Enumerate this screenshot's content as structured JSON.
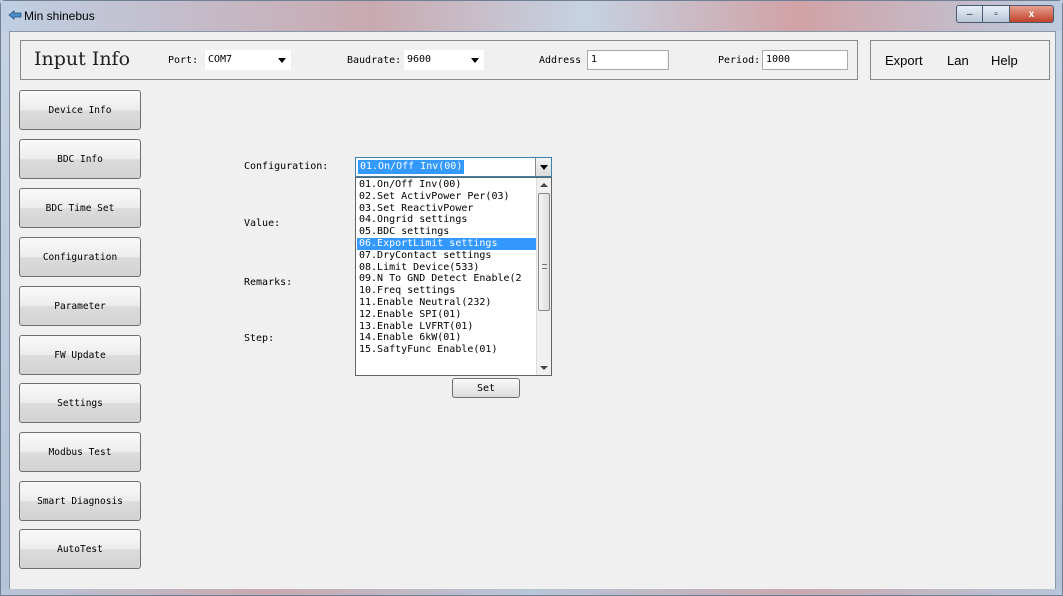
{
  "window": {
    "title": "Min shinebus",
    "icon": "app-icon",
    "controls": {
      "minimize": "–",
      "maximize": "▫",
      "close": "x"
    }
  },
  "infobar": {
    "title": "Input Info",
    "port_label": "Port:",
    "port_value": "COM7",
    "baud_label": "Baudrate:",
    "baud_value": "9600",
    "address_label": "Address",
    "address_value": "1",
    "period_label": "Period:",
    "period_value": "1000"
  },
  "menu": {
    "export": "Export",
    "lan": "Lan",
    "help": "Help"
  },
  "sidebar": {
    "items": [
      {
        "label": "Device Info"
      },
      {
        "label": "BDC Info"
      },
      {
        "label": "BDC Time Set"
      },
      {
        "label": "Configuration"
      },
      {
        "label": "Parameter"
      },
      {
        "label": "FW Update"
      },
      {
        "label": "Settings"
      },
      {
        "label": "Modbus Test"
      },
      {
        "label": "Smart Diagnosis"
      },
      {
        "label": "AutoTest"
      }
    ]
  },
  "form": {
    "configuration_label": "Configuration:",
    "configuration_value": "01.On/Off Inv(00)",
    "value_label": "Value:",
    "remarks_label": "Remarks:",
    "step_label": "Step:",
    "set_button": "Set"
  },
  "dropdown": {
    "highlighted_index": 5,
    "options": [
      "01.On/Off Inv(00)",
      "02.Set ActivPower Per(03)",
      "03.Set ReactivPower",
      "04.Ongrid settings",
      "05.BDC settings",
      "06.ExportLimit settings",
      "07.DryContact settings",
      "08.Limit Device(533)",
      "09.N To GND Detect Enable(2",
      "10.Freq settings",
      "11.Enable Neutral(232)",
      "12.Enable SPI(01)",
      "13.Enable LVFRT(01)",
      "14.Enable 6kW(01)",
      "15.SaftyFunc Enable(01)"
    ]
  },
  "colors": {
    "selection": "#3399ff",
    "client_bg": "#f0f0f0"
  }
}
